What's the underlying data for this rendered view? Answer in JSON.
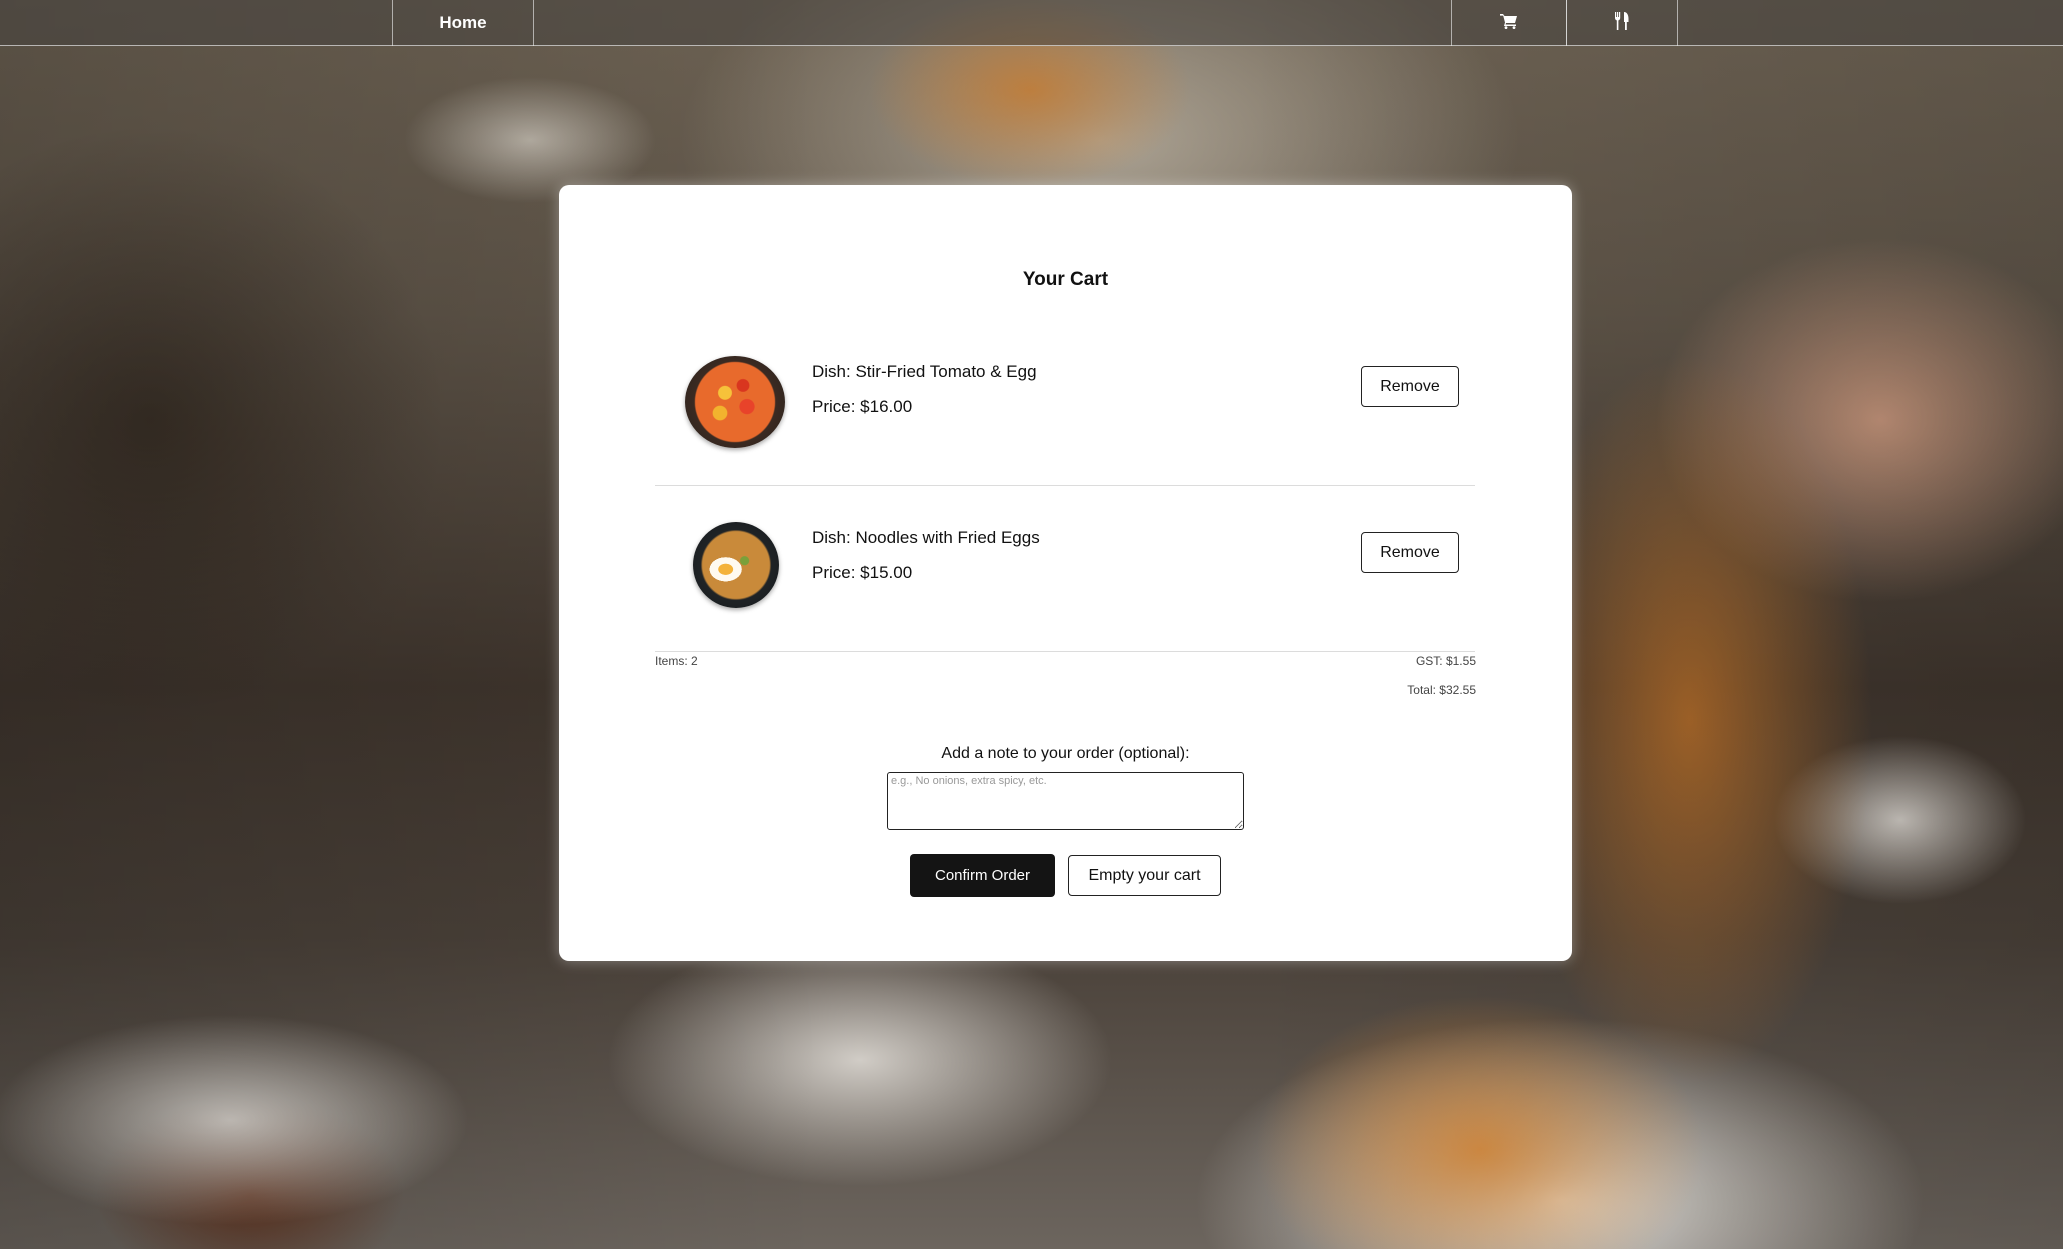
{
  "nav": {
    "home_label": "Home",
    "cart_icon": "shopping-cart-icon",
    "menu_icon": "fork-knife-icon"
  },
  "cart": {
    "title": "Your Cart",
    "items": [
      {
        "dish": "Dish: Stir-Fried Tomato & Egg",
        "price": "Price: $16.00",
        "remove_label": "Remove"
      },
      {
        "dish": "Dish: Noodles with Fried Eggs",
        "price": "Price: $15.00",
        "remove_label": "Remove"
      }
    ],
    "summary": {
      "items": "Items: 2",
      "gst": "GST: $1.55",
      "total": "Total: $32.55"
    },
    "note": {
      "label": "Add a note to your order (optional):",
      "placeholder": "e.g., No onions, extra spicy, etc.",
      "value": ""
    },
    "confirm_label": "Confirm Order",
    "empty_label": "Empty your cart"
  },
  "colors": {
    "primary_button": "#141414",
    "card_background": "#ffffff",
    "nav_text": "#ffffff"
  }
}
